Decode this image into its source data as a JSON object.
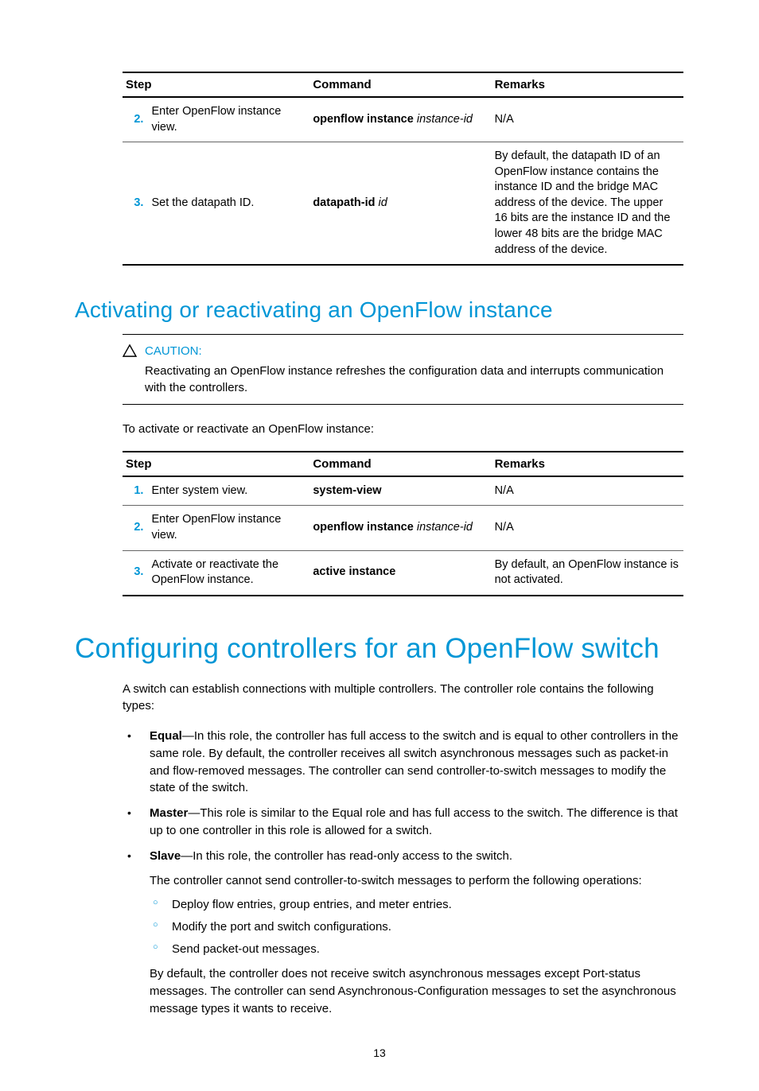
{
  "table1": {
    "headers": {
      "step": "Step",
      "command": "Command",
      "remarks": "Remarks"
    },
    "rows": [
      {
        "num": "2.",
        "step": "Enter OpenFlow instance view.",
        "cmd_bold": "openflow instance",
        "cmd_ital": "instance-id",
        "remarks": "N/A"
      },
      {
        "num": "3.",
        "step": "Set the datapath ID.",
        "cmd_bold": "datapath-id",
        "cmd_ital": "id",
        "remarks": "By default, the datapath ID of an OpenFlow instance contains the instance ID and the bridge MAC address of the device. The upper 16 bits are the instance ID and the lower 48 bits are the bridge MAC address of the device."
      }
    ]
  },
  "section1": {
    "title": "Activating or reactivating an OpenFlow instance",
    "caution_label": "CAUTION:",
    "caution_text": "Reactivating an OpenFlow instance refreshes the configuration data and interrupts communication with the controllers.",
    "intro": "To activate or reactivate an OpenFlow instance:"
  },
  "table2": {
    "headers": {
      "step": "Step",
      "command": "Command",
      "remarks": "Remarks"
    },
    "rows": [
      {
        "num": "1.",
        "step": "Enter system view.",
        "cmd_bold": "system-view",
        "cmd_ital": "",
        "remarks": "N/A"
      },
      {
        "num": "2.",
        "step": "Enter OpenFlow instance view.",
        "cmd_bold": "openflow instance",
        "cmd_ital": "instance-id",
        "remarks": "N/A"
      },
      {
        "num": "3.",
        "step": "Activate or reactivate the OpenFlow instance.",
        "cmd_bold": "active instance",
        "cmd_ital": "",
        "remarks": "By default, an OpenFlow instance is not activated."
      }
    ]
  },
  "section2": {
    "title": "Configuring controllers for an OpenFlow switch",
    "intro": "A switch can establish connections with multiple controllers. The controller role contains the following types:",
    "roles": [
      {
        "name": "Equal",
        "desc": "—In this role, the controller has full access to the switch and is equal to other controllers in the same role. By default, the controller receives all switch asynchronous messages such as packet-in and flow-removed messages. The controller can send controller-to-switch messages to modify the state of the switch."
      },
      {
        "name": "Master",
        "desc": "—This role is similar to the Equal role and has full access to the switch. The difference is that up to one controller in this role is allowed for a switch."
      },
      {
        "name": "Slave",
        "desc": "—In this role, the controller has read-only access to the switch.",
        "para1": "The controller cannot send controller-to-switch messages to perform the following operations:",
        "sub": [
          "Deploy flow entries, group entries, and meter entries.",
          "Modify the port and switch configurations.",
          "Send packet-out messages."
        ],
        "para2": "By default, the controller does not receive switch asynchronous messages except Port-status messages. The controller can send Asynchronous-Configuration messages to set the asynchronous message types it wants to receive."
      }
    ]
  },
  "page_num": "13"
}
